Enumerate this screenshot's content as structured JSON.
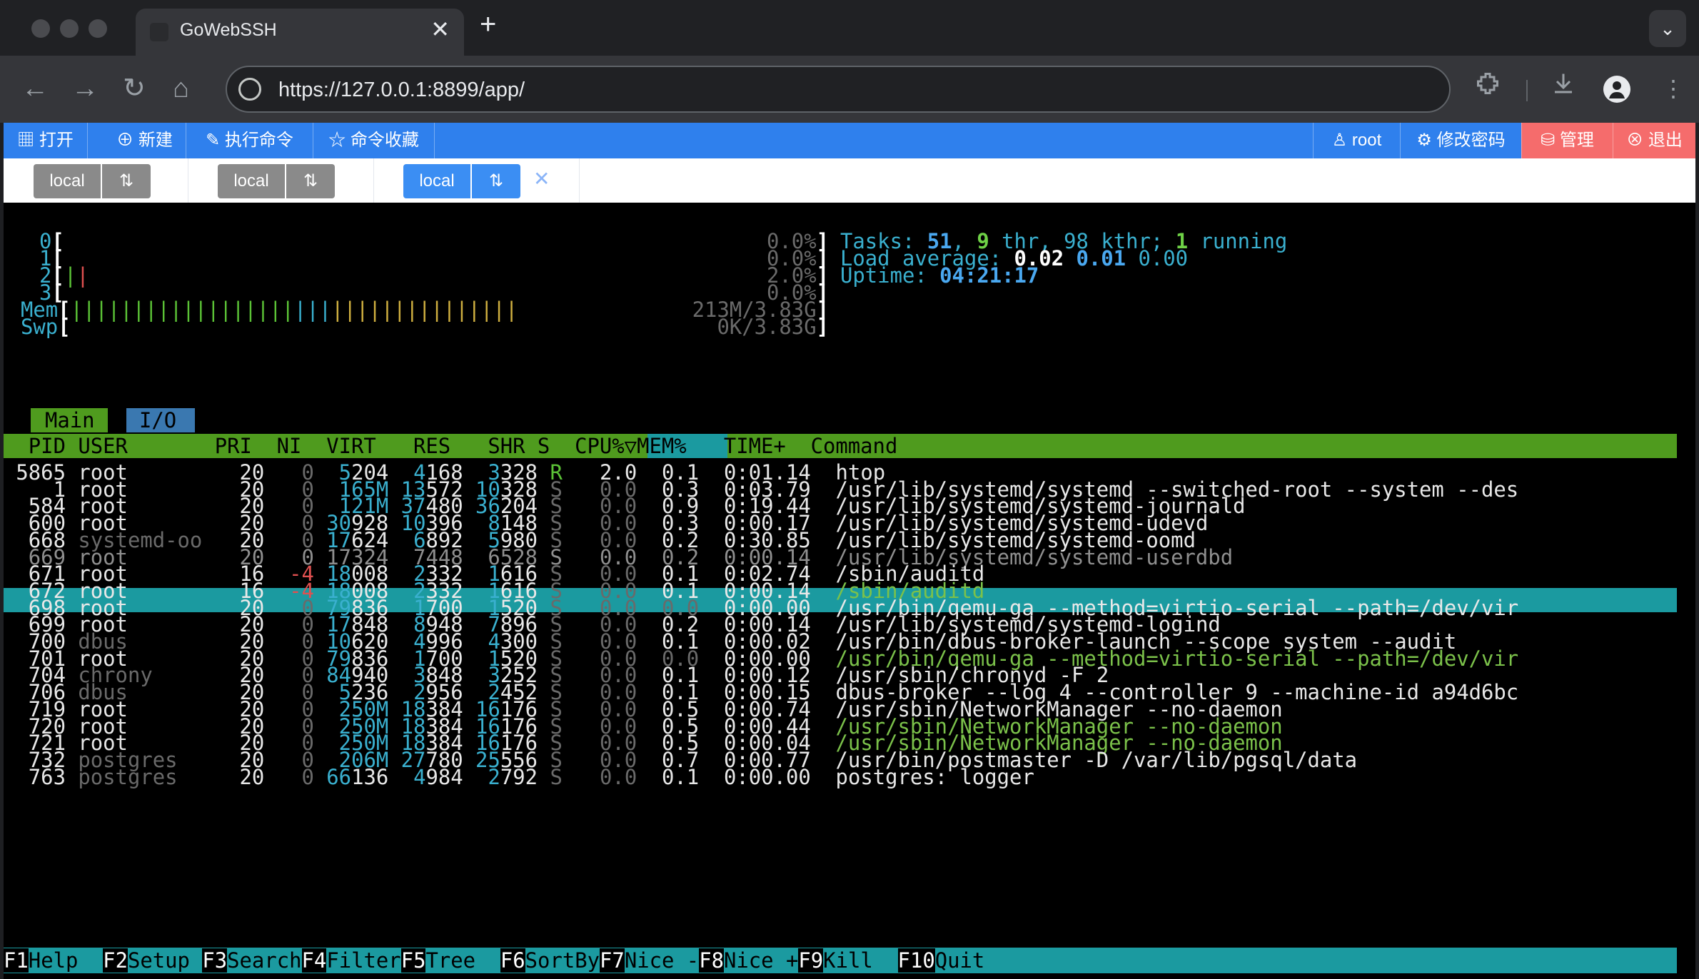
{
  "browser": {
    "tab_title": "GoWebSSH",
    "tab_close": "✕",
    "new_tab": "+",
    "tab_menu": "⌄",
    "url": "https://127.0.0.1:8899/app/",
    "back": "←",
    "forward": "→",
    "reload": "↻",
    "home": "⌂"
  },
  "menubar": {
    "left": [
      {
        "icon": "▦",
        "label": "打开"
      },
      {
        "icon": "⊕",
        "label": "新建"
      },
      {
        "icon": "✎",
        "label": "执行命令"
      },
      {
        "icon": "☆",
        "label": "命令收藏"
      }
    ],
    "user": {
      "icon": "♙",
      "label": "root"
    },
    "change_password": {
      "icon": "⚙",
      "label": "修改密码"
    },
    "manage": {
      "icon": "⛁",
      "label": "管理"
    },
    "logout": {
      "icon": "⊗",
      "label": "退出"
    }
  },
  "sessions": [
    {
      "label": "local",
      "switch": "⇅",
      "active": false
    },
    {
      "label": "local",
      "switch": "⇅",
      "active": false
    },
    {
      "label": "local",
      "switch": "⇅",
      "active": true
    }
  ],
  "session_close": "✕",
  "htop": {
    "meters": [
      {
        "label": "0",
        "bars": "",
        "value": "0.0%"
      },
      {
        "label": "1",
        "bars": "",
        "value": "0.0%"
      },
      {
        "label": "2",
        "bars": "||",
        "value": "2.0%"
      },
      {
        "label": "3",
        "bars": "",
        "value": "0.0%"
      },
      {
        "label": "Mem",
        "bars": "||||||||||||||||||||||||||||||||||||",
        "value": "213M/3.83G"
      },
      {
        "label": "Swp",
        "bars": "",
        "value": "0K/3.83G"
      }
    ],
    "tasks_label": "Tasks: ",
    "tasks": "51",
    "threads": "9",
    "thr_label": " thr, ",
    "kthr": "98",
    "kthr_label": " kthr; ",
    "running": "1",
    "running_label": " running",
    "load_label": "Load average: ",
    "load1": "0.02",
    "load5": "0.01",
    "load15": "0.00",
    "uptime_label": "Uptime: ",
    "uptime": "04:21:17",
    "tab_main": "Main",
    "tab_io": "I/O",
    "header": "  PID USER       PRI  NI  VIRT   RES   SHR S  CPU%▽MEM%   TIME+  Command",
    "processes": [
      {
        "pid": "5865",
        "user": "root",
        "pri": "20",
        "ni": "0",
        "virt": "5204",
        "res": "4168",
        "shr": "3328",
        "s": "R",
        "cpu": "2.0",
        "mem": "0.1",
        "time": "0:01.14",
        "cmd": "htop"
      },
      {
        "pid": "1",
        "user": "root",
        "pri": "20",
        "ni": "0",
        "virt": "165M",
        "res": "13572",
        "shr": "10328",
        "s": "S",
        "cpu": "0.0",
        "mem": "0.3",
        "time": "0:03.79",
        "cmd": "/usr/lib/systemd/systemd --switched-root --system --des"
      },
      {
        "pid": "584",
        "user": "root",
        "pri": "20",
        "ni": "0",
        "virt": "121M",
        "res": "37480",
        "shr": "36204",
        "s": "S",
        "cpu": "0.0",
        "mem": "0.9",
        "time": "0:19.44",
        "cmd": "/usr/lib/systemd/systemd-journald"
      },
      {
        "pid": "600",
        "user": "root",
        "pri": "20",
        "ni": "0",
        "virt": "30928",
        "res": "10396",
        "shr": "8148",
        "s": "S",
        "cpu": "0.0",
        "mem": "0.3",
        "time": "0:00.17",
        "cmd": "/usr/lib/systemd/systemd-udevd"
      },
      {
        "pid": "668",
        "user": "systemd-oo",
        "pri": "20",
        "ni": "0",
        "virt": "17624",
        "res": "6892",
        "shr": "5980",
        "s": "S",
        "cpu": "0.0",
        "mem": "0.2",
        "time": "0:30.85",
        "cmd": "/usr/lib/systemd/systemd-oomd"
      },
      {
        "pid": "669",
        "user": "root",
        "pri": "20",
        "ni": "0",
        "virt": "17324",
        "res": "7448",
        "shr": "6528",
        "s": "S",
        "cpu": "0.0",
        "mem": "0.2",
        "time": "0:00.14",
        "cmd": "/usr/lib/systemd/systemd-userdbd"
      },
      {
        "pid": "671",
        "user": "root",
        "pri": "16",
        "ni": "-4",
        "virt": "18008",
        "res": "2332",
        "shr": "1616",
        "s": "S",
        "cpu": "0.0",
        "mem": "0.1",
        "time": "0:02.74",
        "cmd": "/sbin/auditd"
      },
      {
        "pid": "672",
        "user": "root",
        "pri": "16",
        "ni": "-4",
        "virt": "18008",
        "res": "2332",
        "shr": "1616",
        "s": "S",
        "cpu": "0.0",
        "mem": "0.1",
        "time": "0:00.14",
        "cmd": "/sbin/auditd"
      },
      {
        "pid": "698",
        "user": "root",
        "pri": "20",
        "ni": "0",
        "virt": "79836",
        "res": "1700",
        "shr": "1520",
        "s": "S",
        "cpu": "0.0",
        "mem": "0.0",
        "time": "0:00.00",
        "cmd": "/usr/bin/qemu-ga --method=virtio-serial --path=/dev/vir"
      },
      {
        "pid": "699",
        "user": "root",
        "pri": "20",
        "ni": "0",
        "virt": "17848",
        "res": "8948",
        "shr": "7896",
        "s": "S",
        "cpu": "0.0",
        "mem": "0.2",
        "time": "0:00.14",
        "cmd": "/usr/lib/systemd/systemd-logind"
      },
      {
        "pid": "700",
        "user": "dbus",
        "pri": "20",
        "ni": "0",
        "virt": "10620",
        "res": "4996",
        "shr": "4300",
        "s": "S",
        "cpu": "0.0",
        "mem": "0.1",
        "time": "0:00.02",
        "cmd": "/usr/bin/dbus-broker-launch --scope system --audit"
      },
      {
        "pid": "701",
        "user": "root",
        "pri": "20",
        "ni": "0",
        "virt": "79836",
        "res": "1700",
        "shr": "1520",
        "s": "S",
        "cpu": "0.0",
        "mem": "0.0",
        "time": "0:00.00",
        "cmd": "/usr/bin/qemu-ga --method=virtio-serial --path=/dev/vir"
      },
      {
        "pid": "704",
        "user": "chrony",
        "pri": "20",
        "ni": "0",
        "virt": "84940",
        "res": "3848",
        "shr": "3252",
        "s": "S",
        "cpu": "0.0",
        "mem": "0.1",
        "time": "0:00.12",
        "cmd": "/usr/sbin/chronyd -F 2"
      },
      {
        "pid": "706",
        "user": "dbus",
        "pri": "20",
        "ni": "0",
        "virt": "5236",
        "res": "2956",
        "shr": "2452",
        "s": "S",
        "cpu": "0.0",
        "mem": "0.1",
        "time": "0:00.15",
        "cmd": "dbus-broker --log 4 --controller 9 --machine-id a94d6bc"
      },
      {
        "pid": "719",
        "user": "root",
        "pri": "20",
        "ni": "0",
        "virt": "250M",
        "res": "18384",
        "shr": "16176",
        "s": "S",
        "cpu": "0.0",
        "mem": "0.5",
        "time": "0:00.74",
        "cmd": "/usr/sbin/NetworkManager --no-daemon"
      },
      {
        "pid": "720",
        "user": "root",
        "pri": "20",
        "ni": "0",
        "virt": "250M",
        "res": "18384",
        "shr": "16176",
        "s": "S",
        "cpu": "0.0",
        "mem": "0.5",
        "time": "0:00.44",
        "cmd": "/usr/sbin/NetworkManager --no-daemon"
      },
      {
        "pid": "721",
        "user": "root",
        "pri": "20",
        "ni": "0",
        "virt": "250M",
        "res": "18384",
        "shr": "16176",
        "s": "S",
        "cpu": "0.0",
        "mem": "0.5",
        "time": "0:00.04",
        "cmd": "/usr/sbin/NetworkManager --no-daemon"
      },
      {
        "pid": "732",
        "user": "postgres",
        "pri": "20",
        "ni": "0",
        "virt": "206M",
        "res": "27780",
        "shr": "25556",
        "s": "S",
        "cpu": "0.0",
        "mem": "0.7",
        "time": "0:00.77",
        "cmd": "/usr/bin/postmaster -D /var/lib/pgsql/data"
      },
      {
        "pid": "763",
        "user": "postgres",
        "pri": "20",
        "ni": "0",
        "virt": "66136",
        "res": "4984",
        "shr": "2792",
        "s": "S",
        "cpu": "0.0",
        "mem": "0.1",
        "time": "0:00.00",
        "cmd": "postgres: logger"
      }
    ],
    "function_keys": [
      {
        "key": "F1",
        "label": "Help  "
      },
      {
        "key": "F2",
        "label": "Setup "
      },
      {
        "key": "F3",
        "label": "Search"
      },
      {
        "key": "F4",
        "label": "Filter"
      },
      {
        "key": "F5",
        "label": "Tree  "
      },
      {
        "key": "F6",
        "label": "SortBy"
      },
      {
        "key": "F7",
        "label": "Nice -"
      },
      {
        "key": "F8",
        "label": "Nice +"
      },
      {
        "key": "F9",
        "label": "Kill  "
      },
      {
        "key": "F10",
        "label": "Quit"
      }
    ]
  }
}
